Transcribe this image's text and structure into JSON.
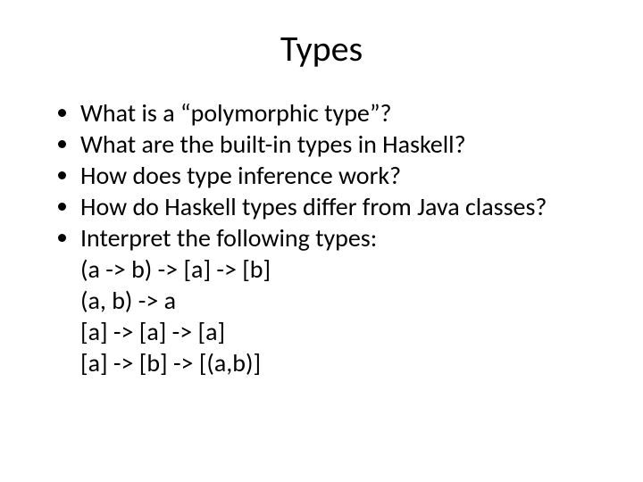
{
  "title": "Types",
  "bullets": {
    "b0": "What is a “polymorphic type”?",
    "b1": "What are the built-in types in Haskell?",
    "b2": "How does type inference work?",
    "b3": "How do Haskell types differ from Java classes?",
    "b4": "Interpret the following types:"
  },
  "sub": {
    "s0": "(a -> b) -> [a] -> [b]",
    "s1": "(a, b) -> a",
    "s2": "[a] -> [a] -> [a]",
    "s3": "[a] -> [b] -> [(a,b)]"
  }
}
